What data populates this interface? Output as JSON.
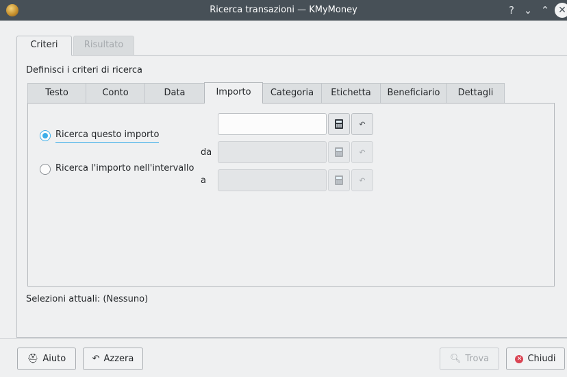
{
  "window": {
    "title": "Ricerca transazioni — KMyMoney",
    "help_glyph": "?",
    "minimize_glyph": "⌄",
    "maximize_glyph": "⌃",
    "close_glyph": "✕"
  },
  "outer_tabs": [
    {
      "label": "Criteri",
      "active": true
    },
    {
      "label": "Risultato",
      "active": false
    }
  ],
  "criteria_header": "Definisci i criteri di ricerca",
  "inner_tabs": [
    {
      "label": "Testo"
    },
    {
      "label": "Conto"
    },
    {
      "label": "Data"
    },
    {
      "label": "Importo",
      "active": true
    },
    {
      "label": "Categoria"
    },
    {
      "label": "Etichetta"
    },
    {
      "label": "Beneficiario"
    },
    {
      "label": "Dettagli"
    }
  ],
  "amount": {
    "search_exact_label": "Ricerca questo importo",
    "search_exact_selected": true,
    "search_range_label": "Ricerca l'importo nell'intervallo",
    "from_label": "da",
    "to_label": "a",
    "exact_value": "",
    "from_value": "",
    "to_value": "",
    "calculator_icon": "calculator-icon",
    "reset_icon": "undo-icon",
    "reset_glyph": "↶"
  },
  "current_selection": "Selezioni attuali: (Nessuno)",
  "buttons": {
    "help": {
      "label": "Aiuto",
      "glyph": "⛑"
    },
    "reset": {
      "label": "Azzera",
      "glyph": "↶"
    },
    "find": {
      "label": "Trova",
      "glyph": "🔍︎",
      "enabled": false
    },
    "close": {
      "label": "Chiudi",
      "glyph": "✕"
    }
  },
  "colors": {
    "titlebar": "#475057",
    "accent": "#3daee9",
    "close_red": "#da4453"
  }
}
